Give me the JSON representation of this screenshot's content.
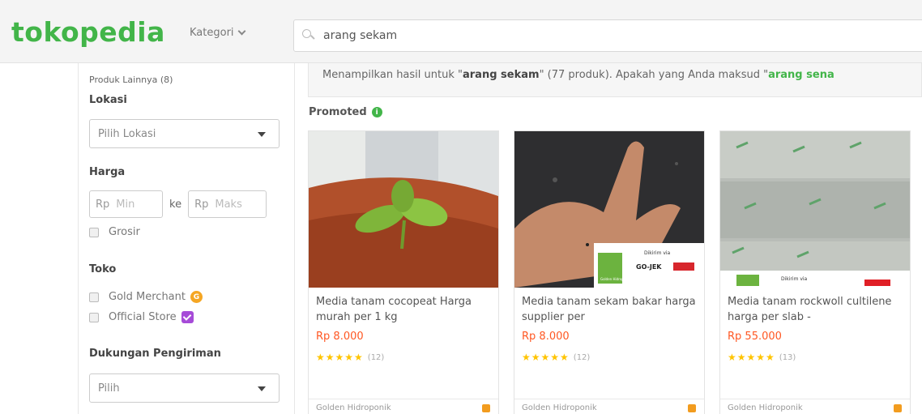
{
  "header": {
    "logo": "tokopedia",
    "kategori_label": "Kategori",
    "search_value": "arang sekam"
  },
  "sidebar": {
    "other_products": "Produk Lainnya (8)",
    "lokasi": {
      "heading": "Lokasi",
      "select_value": "Pilih Lokasi"
    },
    "harga": {
      "heading": "Harga",
      "min_prefix": "Rp",
      "min_placeholder": "Min",
      "separator": "ke",
      "max_prefix": "Rp",
      "max_placeholder": "Maks",
      "grosir": "Grosir"
    },
    "toko": {
      "heading": "Toko",
      "gold_merchant": "Gold Merchant",
      "official_store": "Official Store"
    },
    "pengiriman": {
      "heading": "Dukungan Pengiriman",
      "select_value": "Pilih"
    }
  },
  "banner": {
    "prefix": "Menampilkan hasil untuk \"",
    "query": "arang sekam",
    "middle": "\" (77 produk). Apakah yang Anda maksud \"",
    "suggestion": "arang sena"
  },
  "promoted_label": "Promoted",
  "products": [
    {
      "name": "Media tanam cocopeat Harga murah per 1 kg",
      "price": "Rp 8.000",
      "rating_count": "(12)",
      "shop": "Golden Hidroponik",
      "stars": 5
    },
    {
      "name": "Media tanam sekam bakar harga supplier per",
      "price": "Rp 8.000",
      "rating_count": "(12)",
      "shop": "Golden Hidroponik",
      "stars": 5,
      "image_label_top": "Dikirim via",
      "image_label_brand": "Golden Hidroponik",
      "image_label_gojek": "GO-JEK"
    },
    {
      "name": "Media tanam rockwoll cultilene harga per slab -",
      "price": "Rp 55.000",
      "rating_count": "(13)",
      "shop": "Golden Hidroponik",
      "stars": 5,
      "image_label_top": "Dikirim via"
    }
  ],
  "colors": {
    "brand_green": "#42b549",
    "price_orange": "#ff5722",
    "star_yellow": "#ffc400"
  }
}
